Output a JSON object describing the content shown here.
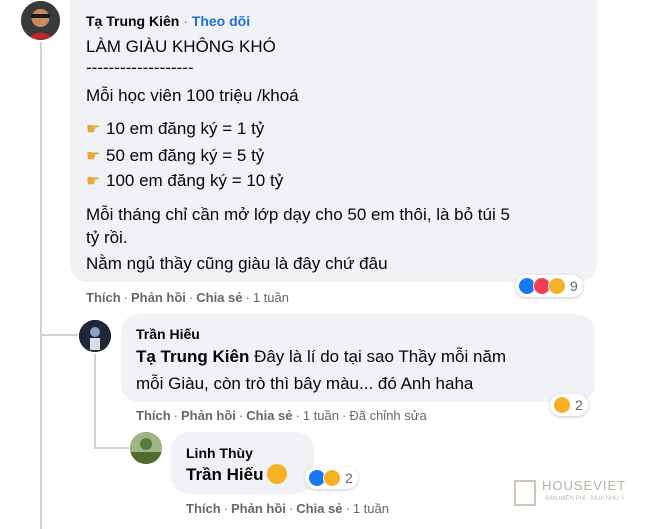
{
  "comment": {
    "author": "Tạ Trung Kiên",
    "separator": "·",
    "follow_label": "Theo dõi",
    "lines": [
      "LÀM GIÀU KHÔNG KHÓ",
      "-------------------",
      "Mỗi học viên 100 triệu /khoá",
      "10 em đăng ký = 1 tỷ",
      "50 em đăng ký = 5 tỷ",
      "100 em đăng ký = 10 tỷ",
      "Mỗi tháng chỉ cần mở lớp dạy cho 50 em thôi, là bỏ túi 5",
      "tỷ rồi.",
      "Nằm ngủ thầy cũng giàu là đây chứ đâu"
    ],
    "bullet_icon": "pointing-hand-icon",
    "actions": {
      "like": "Thích",
      "reply": "Phản hồi",
      "share": "Chia sẻ",
      "dot": "·",
      "time": "1 tuần"
    },
    "reactions": {
      "icons": [
        "like",
        "love",
        "haha"
      ],
      "count": "9"
    }
  },
  "reply1": {
    "author": "Trần Hiếu",
    "mention": "Tạ Trung Kiên",
    "line1_rest": " Đây là lí do tại sao Thầy mỗi năm",
    "line2": "mỗi Giàu, còn trò thì bây màu... đó Anh haha",
    "actions": {
      "like": "Thích",
      "reply": "Phản hồi",
      "share": "Chia sẻ",
      "dot": "·",
      "time": "1 tuần",
      "edited": "Đã chỉnh sửa"
    },
    "reactions": {
      "icons": [
        "haha"
      ],
      "count": "2"
    }
  },
  "reply2": {
    "author": "Linh Thùy",
    "mention": "Trần Hiếu",
    "emoji": "laughing-face-icon",
    "actions": {
      "like": "Thích",
      "reply": "Phản hồi",
      "share": "Chia sẻ",
      "dot": "·",
      "time": "1 tuần"
    },
    "reactions": {
      "icons": [
        "like",
        "haha"
      ],
      "count": "2"
    }
  },
  "watermark": {
    "brand": "HOUSEVIET",
    "tagline": "BÁN MIỄN PHÍ · MUA NHƯ Ý"
  },
  "colors": {
    "bubble": "#f0f2f5",
    "link": "#216fdb",
    "muted": "#65676b",
    "like": "#1877f2",
    "love": "#f33e58",
    "haha": "#f7b125"
  }
}
